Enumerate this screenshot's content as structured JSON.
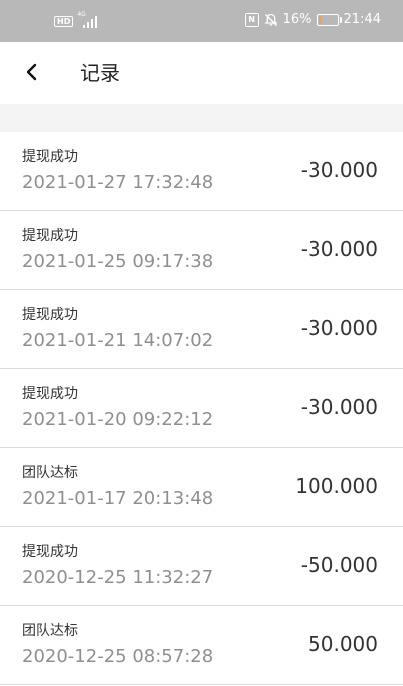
{
  "status_bar": {
    "hd_label": "HD",
    "network_label": "4G",
    "battery_percent": "16%",
    "time": "21:44",
    "battery_level": 0.16,
    "battery_color": "#f2a34c"
  },
  "header": {
    "title": "记录"
  },
  "records": [
    {
      "type": "提现成功",
      "time": "2021-01-27 17:32:48",
      "amount": "-30.000"
    },
    {
      "type": "提现成功",
      "time": "2021-01-25 09:17:38",
      "amount": "-30.000"
    },
    {
      "type": "提现成功",
      "time": "2021-01-21 14:07:02",
      "amount": "-30.000"
    },
    {
      "type": "提现成功",
      "time": "2021-01-20 09:22:12",
      "amount": "-30.000"
    },
    {
      "type": "团队达标",
      "time": "2021-01-17 20:13:48",
      "amount": "100.000"
    },
    {
      "type": "提现成功",
      "time": "2020-12-25 11:32:27",
      "amount": "-50.000"
    },
    {
      "type": "团队达标",
      "time": "2020-12-25 08:57:28",
      "amount": "50.000"
    }
  ]
}
